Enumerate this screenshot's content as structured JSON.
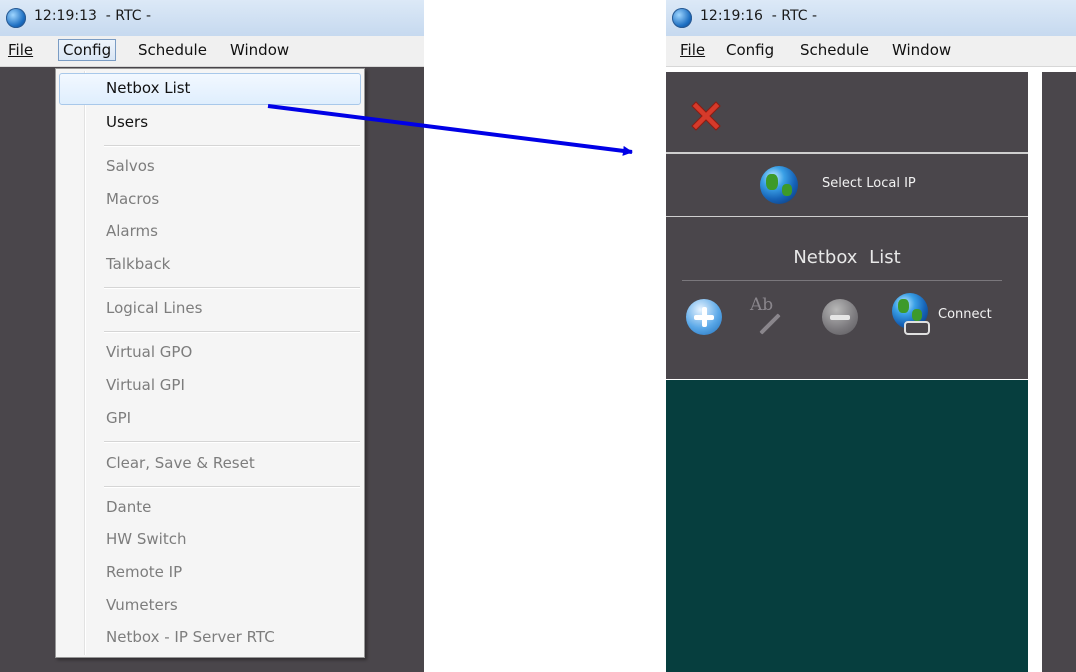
{
  "left_window": {
    "time": "12:19:13",
    "title_suffix": "  - RTC -",
    "menu": [
      "File",
      "Config",
      "Schedule",
      "Window"
    ],
    "config_menu": {
      "items": [
        {
          "label": "Netbox List",
          "enabled": true,
          "highlighted": true
        },
        {
          "label": "Users",
          "enabled": true
        },
        {
          "label": "Salvos",
          "enabled": false
        },
        {
          "label": "Macros",
          "enabled": false
        },
        {
          "label": "Alarms",
          "enabled": false
        },
        {
          "label": "Talkback",
          "enabled": false
        },
        {
          "label": "Logical Lines",
          "enabled": false
        },
        {
          "label": "Virtual GPO",
          "enabled": false
        },
        {
          "label": "Virtual GPI",
          "enabled": false
        },
        {
          "label": "GPI",
          "enabled": false
        },
        {
          "label": "Clear, Save & Reset",
          "enabled": false
        },
        {
          "label": "Dante",
          "enabled": false
        },
        {
          "label": "HW Switch",
          "enabled": false
        },
        {
          "label": "Remote IP",
          "enabled": false
        },
        {
          "label": "Vumeters",
          "enabled": false
        },
        {
          "label": "Netbox - IP Server RTC",
          "enabled": false
        }
      ]
    }
  },
  "right_window": {
    "time": "12:19:16",
    "title_suffix": "  - RTC -",
    "menu": [
      "File",
      "Config",
      "Schedule",
      "Window"
    ],
    "close_icon": "red-x-icon",
    "select_local_ip": "Select Local IP",
    "netbox_list_title": "Netbox  List",
    "toolbar": {
      "add_icon": "plus-circle-icon",
      "rename_icon": "rename-ab-icon",
      "remove_icon": "minus-circle-icon",
      "connect_label": "Connect"
    }
  },
  "colors": {
    "panel_dark": "#4a464b",
    "list_bg": "#063e3e",
    "arrow": "#0000e6",
    "close_red": "#d63a2a"
  }
}
